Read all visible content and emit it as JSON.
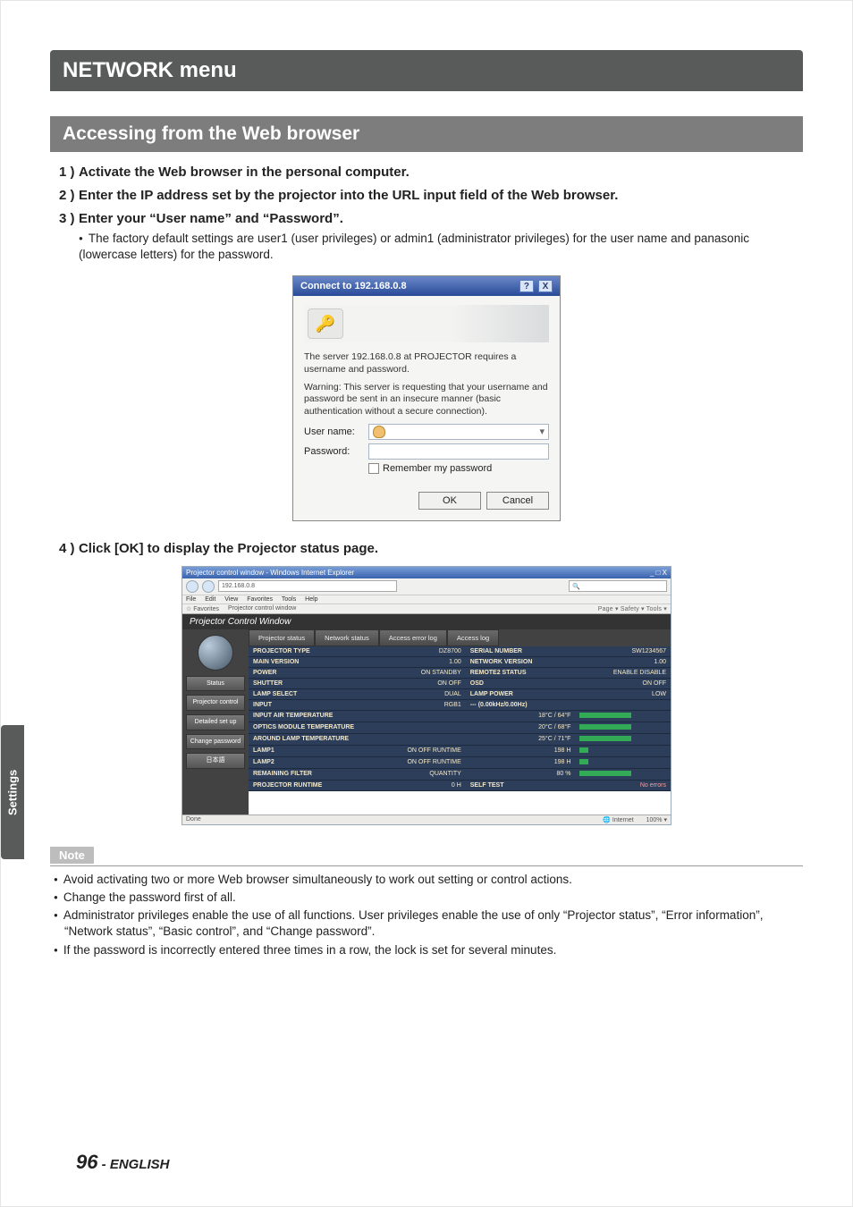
{
  "title_bar": "NETWORK menu",
  "sub_bar": "Accessing from the Web browser",
  "steps": [
    {
      "num": "1 )",
      "text": "Activate the Web browser in the personal computer."
    },
    {
      "num": "2 )",
      "text": "Enter the IP address set by the projector into the URL input field of the Web browser."
    },
    {
      "num": "3 )",
      "text": "Enter your “User name” and “Password”.",
      "sub": [
        "The factory default settings are user1 (user privileges) or admin1 (administrator privileges) for the user name and panasonic (lowercase letters) for the password."
      ]
    }
  ],
  "login_dialog": {
    "title": "Connect to 192.168.0.8",
    "msg1": "The server 192.168.0.8 at PROJECTOR requires a username and password.",
    "msg2": "Warning: This server is requesting that your username and password be sent in an insecure manner (basic authentication without a secure connection).",
    "user_label": "User name:",
    "pass_label": "Password:",
    "remember": "Remember my password",
    "ok": "OK",
    "cancel": "Cancel"
  },
  "step4": {
    "num": "4 )",
    "text": "Click [OK] to display the Projector status page."
  },
  "pcw": {
    "window_title": "Projector control window - Windows Internet Explorer",
    "address": "192.168.0.8",
    "search_hint": "",
    "menu": [
      "File",
      "Edit",
      "View",
      "Favorites",
      "Tools",
      "Help"
    ],
    "fav_left": "Favorites",
    "fav_item": "Projector control window",
    "fav_right": "Page ▾  Safety ▾  Tools ▾",
    "header": "Projector Control Window",
    "side": [
      "Status",
      "Projector control",
      "Detailed set up",
      "Change password",
      "日本語"
    ],
    "tabs": [
      "Projector status",
      "Network status",
      "Access error log",
      "Access log"
    ],
    "rows": [
      [
        "PROJECTOR TYPE",
        "DZ8700",
        "SERIAL NUMBER",
        "SW1234567"
      ],
      [
        "MAIN VERSION",
        "1.00",
        "NETWORK VERSION",
        "1.00"
      ],
      [
        "POWER",
        "ON   STANDBY",
        "REMOTE2 STATUS",
        "ENABLE   DISABLE"
      ],
      [
        "SHUTTER",
        "ON   OFF",
        "OSD",
        "ON   OFF"
      ],
      [
        "LAMP SELECT",
        "DUAL",
        "LAMP POWER",
        "LOW"
      ],
      [
        "INPUT",
        "RGB1",
        "--- (0.00kHz/0.00Hz)",
        ""
      ],
      [
        "INPUT AIR TEMPERATURE",
        "18°C / 64°F",
        "BAR",
        ""
      ],
      [
        "OPTICS MODULE TEMPERATURE",
        "20°C / 68°F",
        "BAR",
        ""
      ],
      [
        "AROUND LAMP TEMPERATURE",
        "25°C / 71°F",
        "BAR",
        ""
      ],
      [
        "LAMP1",
        "ON   OFF   RUNTIME",
        "198 H",
        "BARSM"
      ],
      [
        "LAMP2",
        "ON   OFF   RUNTIME",
        "198 H",
        "BARSM"
      ],
      [
        "REMAINING FILTER",
        "QUANTITY",
        "80 %",
        "BAR"
      ],
      [
        "PROJECTOR RUNTIME",
        "0 H",
        "SELF TEST",
        "No errors"
      ]
    ],
    "status_done": "Done",
    "status_zone": "Internet",
    "status_zoom": "100%"
  },
  "note_label": "Note",
  "notes": [
    "Avoid activating two or more Web browser simultaneously to work out setting or control actions.",
    "Change the password first of all.",
    "Administrator privileges enable the use of all functions. User privileges enable the use of only “Projector status”, “Error information”, “Network status”, “Basic control”, and “Change password”.",
    "If the password is incorrectly entered three times in a row, the lock is set for several minutes."
  ],
  "side_tab": "Settings",
  "footer": {
    "num": "96",
    "sep": " - ",
    "lang": "ENGLISH"
  }
}
